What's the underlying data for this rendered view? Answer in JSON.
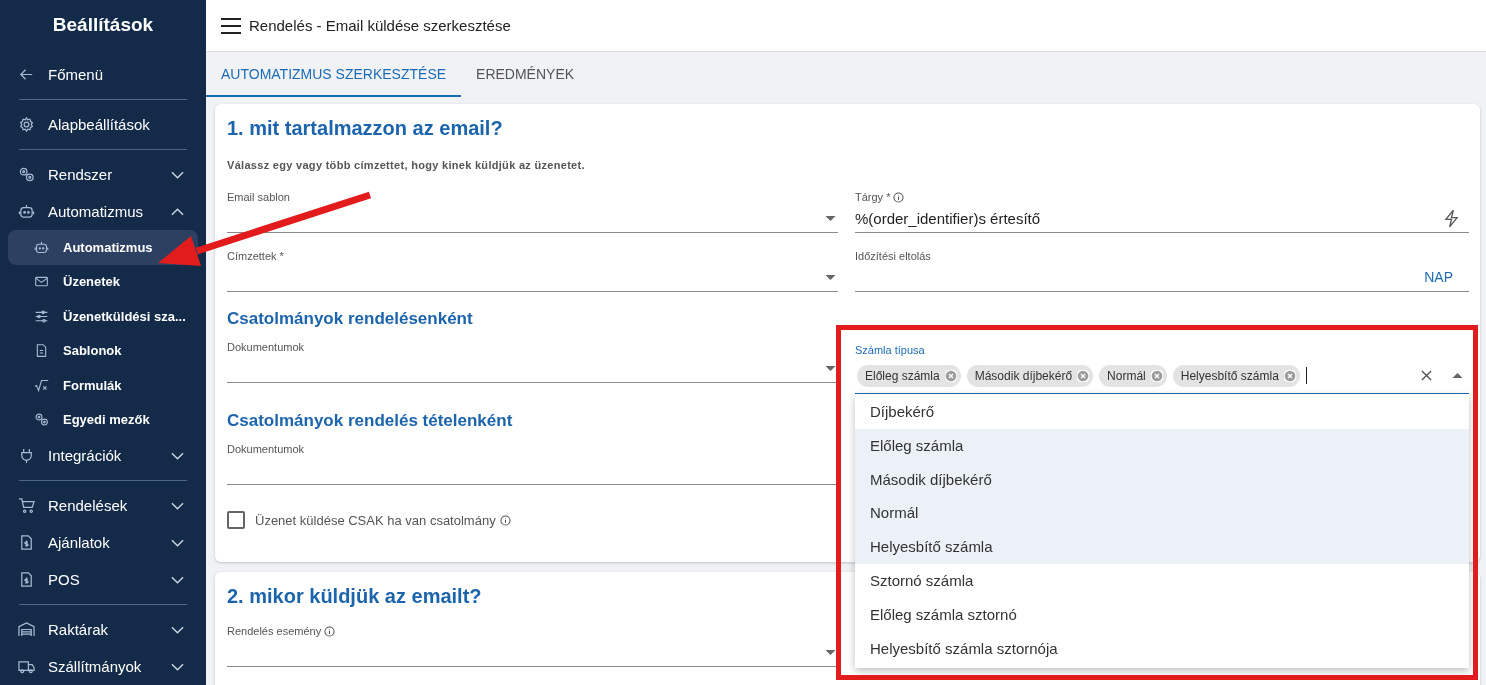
{
  "sidebar": {
    "title": "Beállítások",
    "groups": [
      {
        "items": [
          {
            "label": "Főmenü"
          }
        ]
      },
      {
        "items": [
          {
            "label": "Alapbeállítások"
          }
        ]
      },
      {
        "items": [
          {
            "label": "Rendszer",
            "expanded": false
          },
          {
            "label": "Automatizmus",
            "expanded": true,
            "children": [
              {
                "label": "Automatizmus",
                "selected": true
              },
              {
                "label": "Üzenetek",
                "selected": false
              },
              {
                "label": "Üzenetküldési sza...",
                "selected": false
              },
              {
                "label": "Sablonok",
                "selected": false
              },
              {
                "label": "Formulák",
                "selected": false
              },
              {
                "label": "Egyedi mezők",
                "selected": false
              }
            ]
          },
          {
            "label": "Integrációk",
            "expanded": false
          }
        ]
      },
      {
        "items": [
          {
            "label": "Rendelések",
            "expanded": false
          },
          {
            "label": "Ajánlatok",
            "expanded": false
          },
          {
            "label": "POS",
            "expanded": false
          }
        ]
      },
      {
        "items": [
          {
            "label": "Raktárak",
            "expanded": false
          },
          {
            "label": "Szállítmányok",
            "expanded": false
          }
        ]
      }
    ]
  },
  "topbar": {
    "title": "Rendelés - Email küldése szerkesztése"
  },
  "tabs": [
    {
      "label": "AUTOMATIZMUS SZERKESZTÉSE",
      "selected": true
    },
    {
      "label": "EREDMÉNYEK",
      "selected": false
    }
  ],
  "section_1": {
    "title": "1. mit tartalmazzon az email?",
    "description": "Válassz egy vagy több címzettet, hogy kinek küldjük az üzenetet.",
    "rows": [
      {
        "left": {
          "kind": "select",
          "label": "Email sablon"
        },
        "right": {
          "kind": "text",
          "label": "Tárgy *",
          "info": true,
          "value": "%(order_identifier)s értesítő",
          "action": true
        }
      },
      {
        "left": {
          "kind": "select",
          "label": "Címzettek *"
        },
        "right": {
          "kind": "text",
          "label": "Időzítési eltolás",
          "suffix": "NAP"
        }
      },
      {
        "left": {
          "kind": "heading",
          "label": "Csatolmányok rendelésenként"
        }
      },
      {
        "left": {
          "kind": "select",
          "label": "Dokumentumok"
        },
        "right": {
          "kind": "multiselect",
          "label": "Számla típusa",
          "chips": [
            "Előleg számla",
            "Második díjbekérő",
            "Normál",
            "Helyesbítő számla"
          ],
          "options": [
            {
              "label": "Díjbekérő",
              "selected": false
            },
            {
              "label": "Előleg számla",
              "selected": true
            },
            {
              "label": "Második díjbekérő",
              "selected": true
            },
            {
              "label": "Normál",
              "selected": true
            },
            {
              "label": "Helyesbítő számla",
              "selected": true
            },
            {
              "label": "Sztornó számla",
              "selected": false
            },
            {
              "label": "Előleg számla sztornó",
              "selected": false
            },
            {
              "label": "Helyesbítő számla sztornója",
              "selected": false
            }
          ]
        }
      },
      {
        "left": {
          "kind": "heading",
          "label": "Csatolmányok rendelés tételenként"
        }
      },
      {
        "left": {
          "kind": "text",
          "label": "Dokumentumok"
        }
      },
      {
        "left": {
          "kind": "checkbox",
          "label": "Üzenet küldése CSAK ha van csatolmány",
          "info": true,
          "checked": false
        }
      }
    ]
  },
  "section_2": {
    "title": "2. mikor küldjük az emailt?",
    "rows": [
      {
        "left": {
          "kind": "select",
          "label": "Rendelés esemény",
          "info": true
        }
      }
    ]
  }
}
